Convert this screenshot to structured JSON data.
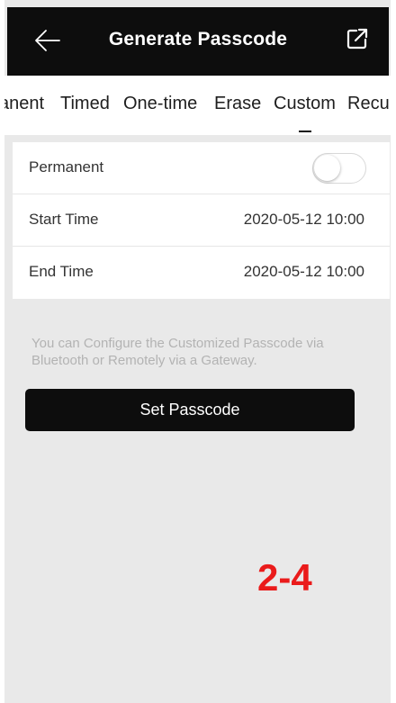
{
  "header": {
    "title": "Generate Passcode",
    "back_icon": "arrow-left-icon",
    "share_icon": "external-link-icon"
  },
  "tabs": [
    {
      "label": "anent"
    },
    {
      "label": "Timed"
    },
    {
      "label": "One-time"
    },
    {
      "label": "Erase"
    },
    {
      "label": "Custom",
      "active": true
    },
    {
      "label": "Recu"
    }
  ],
  "settings": {
    "permanent_label": "Permanent",
    "permanent_on": false,
    "start_label": "Start Time",
    "start_value": "2020-05-12 10:00",
    "end_label": "End Time",
    "end_value": "2020-05-12 10:00"
  },
  "hint": "You can Configure the Customized Passcode via Bluetooth or Remotely via a Gateway.",
  "button": {
    "label": "Set Passcode"
  },
  "overlay": {
    "label": "2-4"
  },
  "colors": {
    "header_bg": "#0d0d0d",
    "page_bg": "#e9e9e9",
    "annotation": "#ea1b1b"
  }
}
